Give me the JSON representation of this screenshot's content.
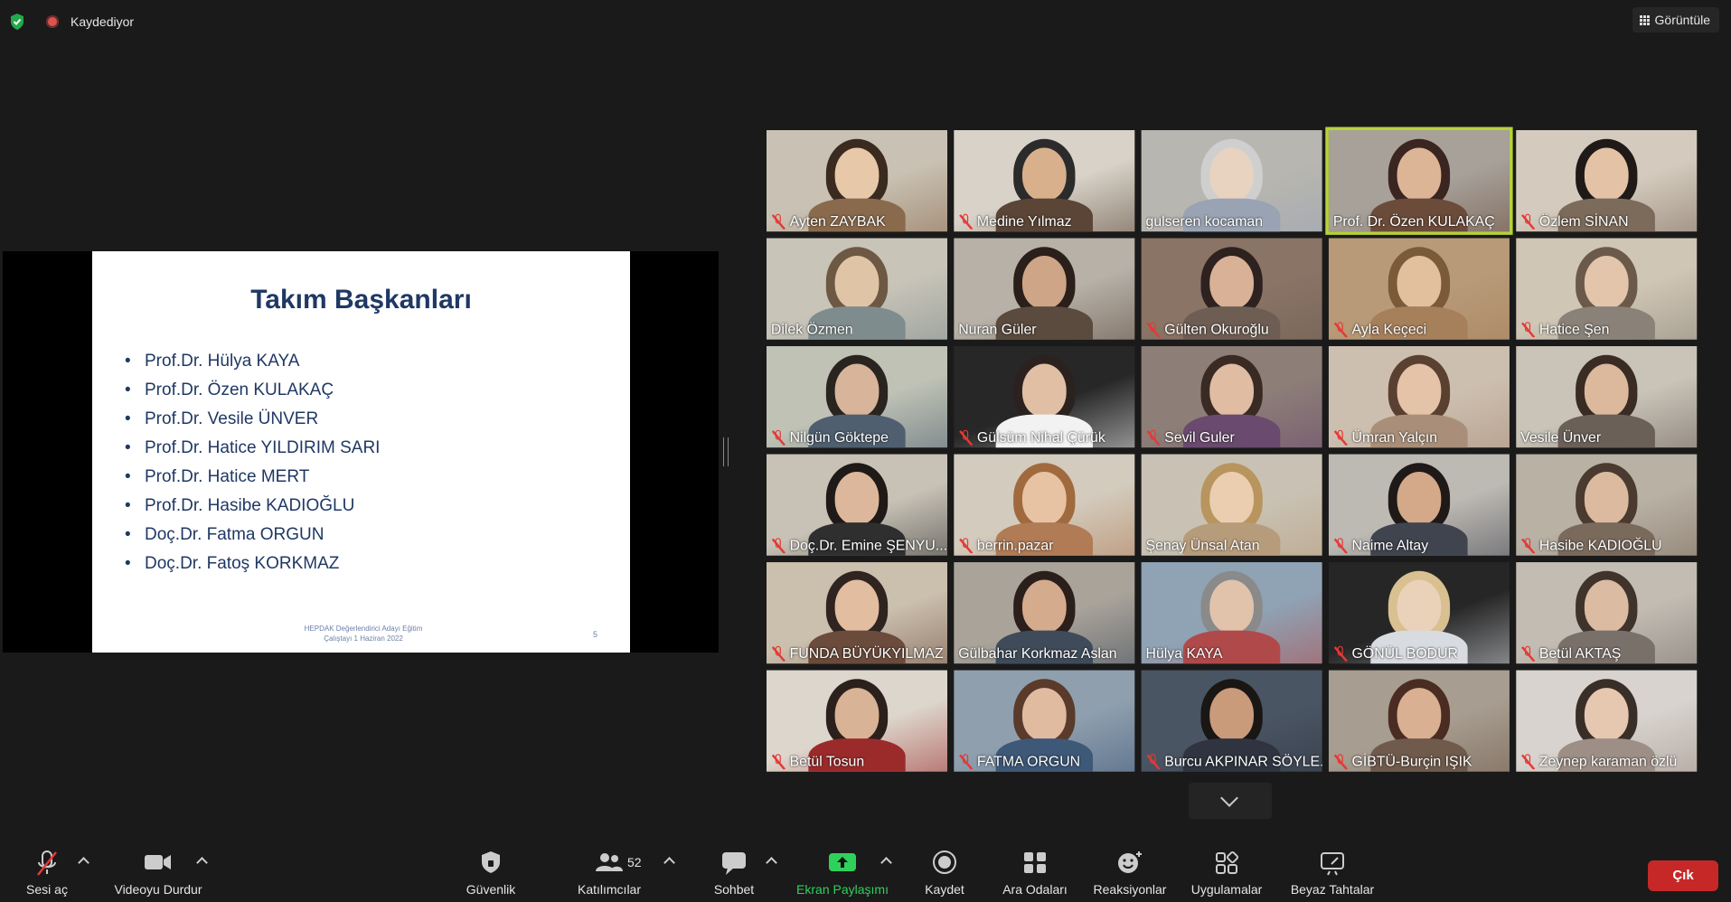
{
  "top": {
    "recording_label": "Kaydediyor",
    "view_label": "Görüntüle"
  },
  "slide": {
    "title": "Takım Başkanları",
    "items": [
      "Prof.Dr. Hülya KAYA",
      "Prof.Dr. Özen KULAKAÇ",
      "Prof.Dr. Vesile ÜNVER",
      "Prof.Dr. Hatice YILDIRIM SARI",
      "Prof.Dr. Hatice MERT",
      "Prof.Dr. Hasibe KADIOĞLU",
      "Doç.Dr. Fatma ORGUN",
      "Doç.Dr. Fatoş KORKMAZ"
    ],
    "footer_line1": "HEPDAK Değerlendirici Adayı Eğitim",
    "footer_line2": "Çalıştayı 1 Haziran 2022",
    "page_number": "5"
  },
  "participants": [
    {
      "name": "Ayten ZAYBAK",
      "muted": true
    },
    {
      "name": "Medine Yılmaz",
      "muted": true
    },
    {
      "name": "gulseren kocaman",
      "muted": false
    },
    {
      "name": "Prof. Dr. Özen KULAKAÇ",
      "muted": false,
      "active": true
    },
    {
      "name": "Özlem SİNAN",
      "muted": true
    },
    {
      "name": "Dilek Özmen",
      "muted": false
    },
    {
      "name": "Nuran Güler",
      "muted": false
    },
    {
      "name": "Gülten Okuroğlu",
      "muted": true
    },
    {
      "name": "Ayla Keçeci",
      "muted": true
    },
    {
      "name": "Hatice Şen",
      "muted": true
    },
    {
      "name": "Nilgün Göktepe",
      "muted": true
    },
    {
      "name": "Gülsüm Nihal Çürük",
      "muted": true
    },
    {
      "name": "Sevil Guler",
      "muted": true
    },
    {
      "name": "Ümran Yalçın",
      "muted": true
    },
    {
      "name": "Vesile Ünver",
      "muted": false
    },
    {
      "name": "Doç.Dr. Emine ŞENYU...",
      "muted": true
    },
    {
      "name": "berrin.pazar",
      "muted": true
    },
    {
      "name": "Şenay Ünsal Atan",
      "muted": false
    },
    {
      "name": "Naime Altay",
      "muted": true
    },
    {
      "name": "Hasibe KADIOĞLU",
      "muted": true
    },
    {
      "name": "FUNDA BÜYÜKYILMAZ",
      "muted": true
    },
    {
      "name": "Gülbahar Korkmaz Aslan",
      "muted": false
    },
    {
      "name": "Hülya KAYA",
      "muted": false
    },
    {
      "name": "GÖNÜL BODUR",
      "muted": true
    },
    {
      "name": "Betül AKTAŞ",
      "muted": true
    },
    {
      "name": "Betül Tosun",
      "muted": true
    },
    {
      "name": "FATMA ORGUN",
      "muted": true
    },
    {
      "name": "Burcu AKPINAR SÖYLE...",
      "muted": true
    },
    {
      "name": "GİBTÜ-Burçin IŞIK",
      "muted": true
    },
    {
      "name": "Zeynep karaman özlü",
      "muted": true
    }
  ],
  "toolbar": {
    "unmute": "Sesi aç",
    "stop_video": "Videoyu Durdur",
    "security": "Güvenlik",
    "participants": "Katılımcılar",
    "participants_count": "52",
    "chat": "Sohbet",
    "share_screen": "Ekran Paylaşımı",
    "record": "Kaydet",
    "breakout": "Ara Odaları",
    "reactions": "Reaksiyonlar",
    "apps": "Uygulamalar",
    "whiteboard": "Beyaz Tahtalar",
    "leave": "Çık"
  },
  "colors": {
    "background": "#1a1a1a",
    "active_speaker": "#b7d23a",
    "share_green": "#2fd15d",
    "leave_red": "#c62828",
    "slide_text": "#1f3864"
  }
}
